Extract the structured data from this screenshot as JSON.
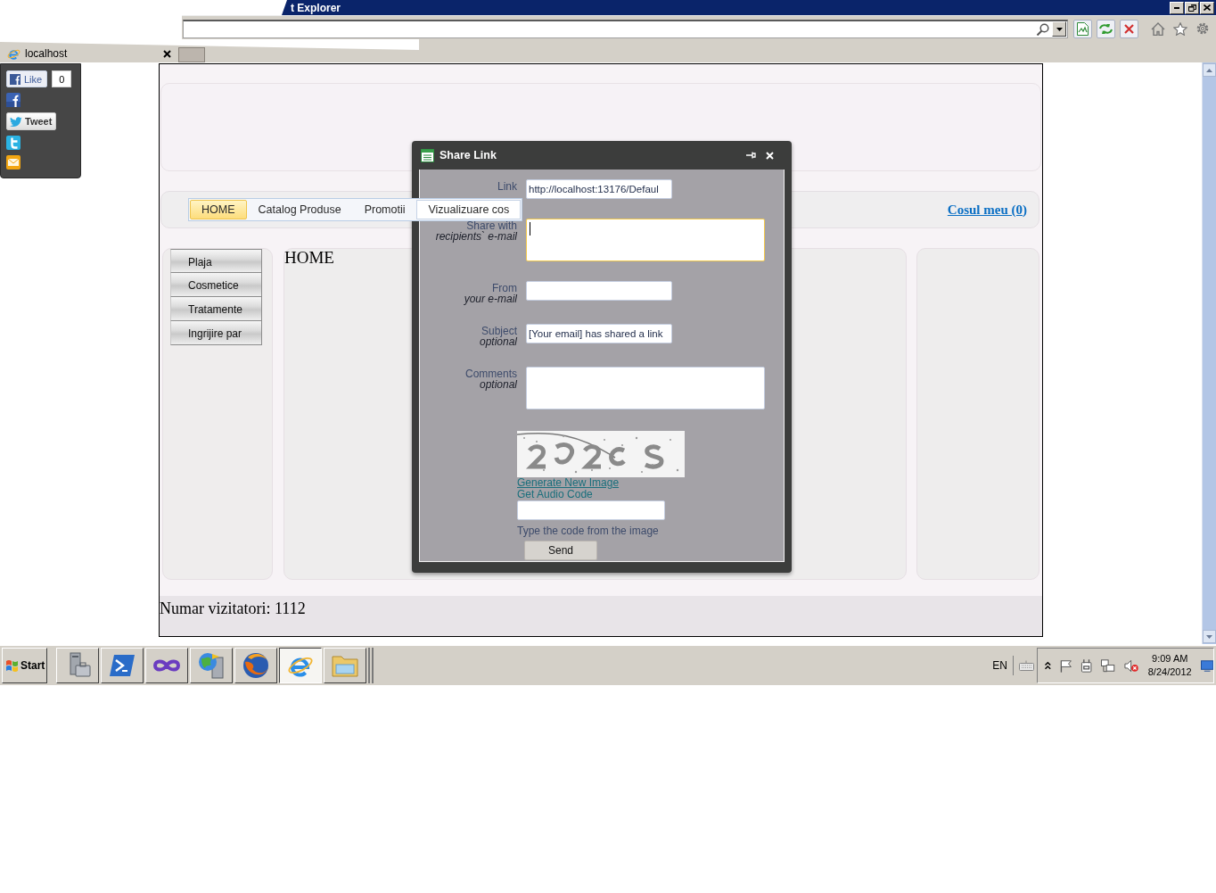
{
  "window": {
    "title": "t Explorer"
  },
  "tabs": [
    {
      "label": "localhost",
      "selected": true
    }
  ],
  "share_widget": {
    "like": {
      "label": "Like",
      "count": "0"
    },
    "tweet": {
      "label": "Tweet"
    }
  },
  "page": {
    "nav": [
      {
        "label": "HOME",
        "selected": true,
        "hovered": false
      },
      {
        "label": "Catalog Produse",
        "selected": false,
        "hovered": false
      },
      {
        "label": "Promotii",
        "selected": false,
        "hovered": false
      },
      {
        "label": "Vizualizuare cos",
        "selected": false,
        "hovered": true
      }
    ],
    "cart_link": "Cosul meu (0)",
    "categories": [
      "Plaja",
      "Cosmetice",
      "Tratamente",
      "Ingrijire par"
    ],
    "heading": "HOME",
    "visitors": "Numar vizitatori: 1112"
  },
  "dialog": {
    "title": "Share Link",
    "fields": [
      {
        "label": "Link",
        "kind": "input",
        "value": "http://localhost:13176/Defaul",
        "focused": false
      },
      {
        "label": "Share with",
        "hint": "recipients` e-mail",
        "kind": "textarea",
        "focused": true
      },
      {
        "label": "From",
        "hint": "your e-mail",
        "kind": "input",
        "focused": false
      },
      {
        "label": "Subject",
        "hint": "optional",
        "kind": "input",
        "value": "[Your email] has shared a link",
        "focused": false
      },
      {
        "label": "Comments",
        "hint": "optional",
        "kind": "textarea",
        "focused": false
      }
    ],
    "captcha_links": [
      {
        "label": "Generate New Image",
        "hovered": true
      },
      {
        "label": "Get Audio Code",
        "hovered": false
      }
    ],
    "instruction": "Type the code from the image",
    "send_button": "Send"
  },
  "taskbar": {
    "start": "Start",
    "apps": [
      {
        "kind": "server-manager",
        "selected": false
      },
      {
        "kind": "powershell",
        "selected": false
      },
      {
        "kind": "visual-studio",
        "selected": false
      },
      {
        "kind": "network-server",
        "selected": false
      },
      {
        "kind": "firefox",
        "selected": false
      },
      {
        "kind": "internet-explorer",
        "selected": true
      },
      {
        "kind": "explorer",
        "selected": false
      }
    ],
    "language": "EN",
    "time": "9:09 AM",
    "date": "8/24/2012"
  }
}
